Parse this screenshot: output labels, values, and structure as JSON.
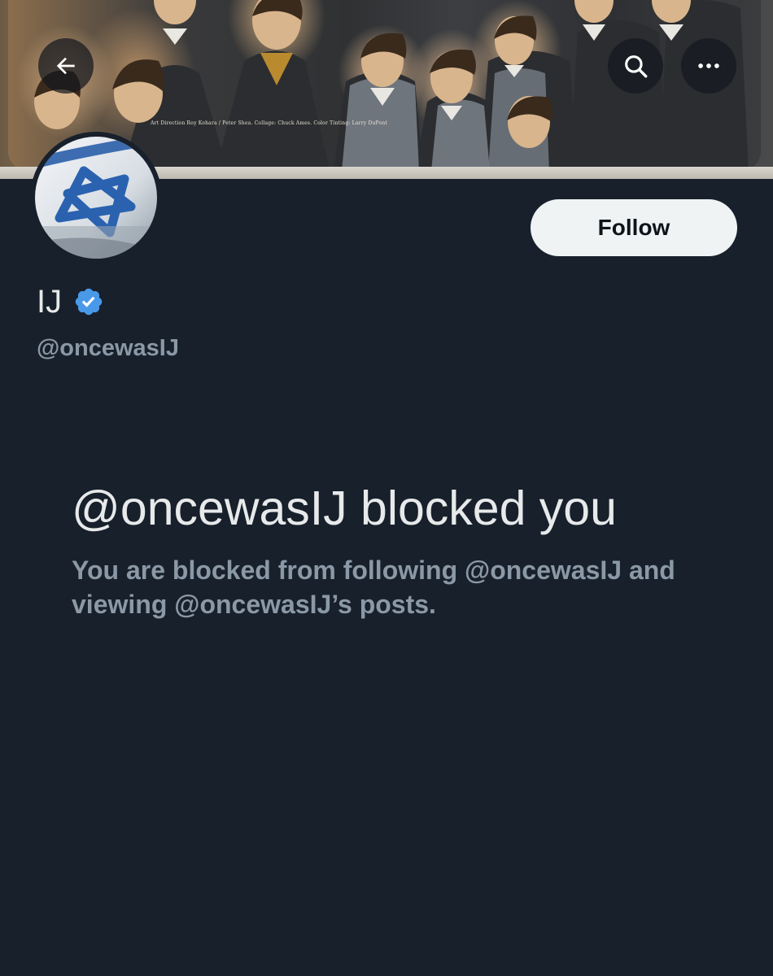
{
  "header": {
    "banner_caption": "Art Direction Roy Kohara / Peter Shea. Collage: Chuck Ames. Color Tinting: Larry DuPont",
    "back_icon": "arrow-left-icon",
    "search_icon": "search-icon",
    "more_icon": "more-horizontal-icon"
  },
  "profile": {
    "display_name": "IJ",
    "verified": true,
    "verified_color": "#4a99e9",
    "handle": "@oncewasIJ",
    "follow_label": "Follow"
  },
  "blocked": {
    "title": "@oncewasIJ blocked you",
    "message": "You are blocked from following @oncewasIJ and viewing @oncewasIJ’s posts."
  },
  "colors": {
    "background": "#17202b",
    "primary_text": "#e7e9ea",
    "secondary_text": "#8b98a5",
    "follow_button_bg": "#eff3f4"
  }
}
